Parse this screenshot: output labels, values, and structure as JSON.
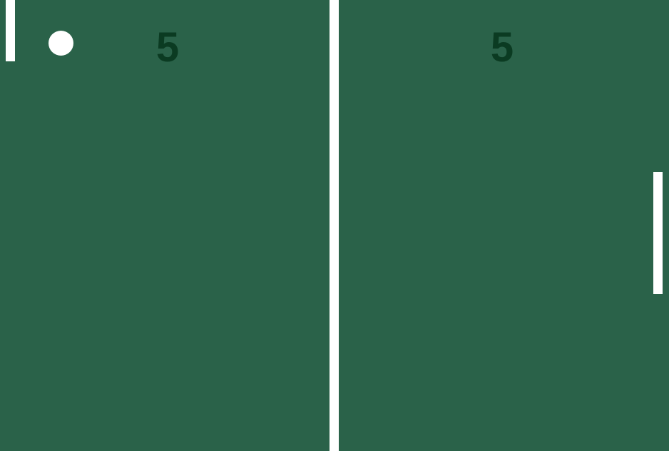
{
  "scoreboard": {
    "left_score": "5",
    "right_score": "5"
  },
  "colors": {
    "court": "#2a6249",
    "lines_and_objects": "#ffffff",
    "score_text": "#0b3b22"
  }
}
